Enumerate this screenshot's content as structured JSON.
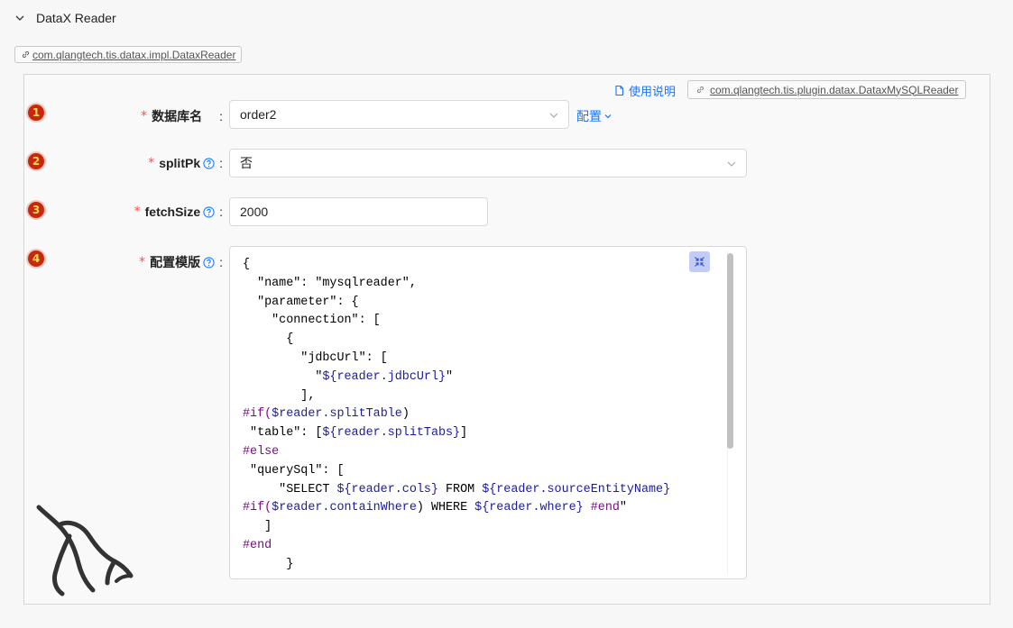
{
  "section": {
    "title": "DataX Reader",
    "impl_class": "com.qlangtech.tis.datax.impl.DataxReader"
  },
  "plugin": {
    "doc_link": "使用说明",
    "class_name": "com.qlangtech.tis.plugin.datax.DataxMySQLReader"
  },
  "fields": [
    {
      "index": "1",
      "label": "数据库名",
      "value": "order2",
      "config_link": "配置"
    },
    {
      "index": "2",
      "label": "splitPk",
      "value": "否"
    },
    {
      "index": "3",
      "label": "fetchSize",
      "value": "2000"
    },
    {
      "index": "4",
      "label": "配置模版"
    }
  ],
  "editor": {
    "lines": [
      [
        {
          "t": "{",
          "c": ""
        }
      ],
      [
        {
          "t": "  \"name\": \"mysqlreader\",",
          "c": ""
        }
      ],
      [
        {
          "t": "  \"parameter\": {",
          "c": ""
        }
      ],
      [
        {
          "t": "    \"connection\": [",
          "c": ""
        }
      ],
      [
        {
          "t": "      {",
          "c": ""
        }
      ],
      [
        {
          "t": "        \"jdbcUrl\": [",
          "c": ""
        }
      ],
      [
        {
          "t": "          \"",
          "c": ""
        },
        {
          "t": "${reader.jdbcUrl}",
          "c": "var"
        },
        {
          "t": "\"",
          "c": ""
        }
      ],
      [
        {
          "t": "        ],",
          "c": ""
        }
      ],
      [
        {
          "t": "#if(",
          "c": "kw"
        },
        {
          "t": "$reader.splitTable",
          "c": "var"
        },
        {
          "t": ")",
          "c": ""
        }
      ],
      [
        {
          "t": " \"table\": [",
          "c": ""
        },
        {
          "t": "${reader.splitTabs}",
          "c": "var"
        },
        {
          "t": "]",
          "c": ""
        }
      ],
      [
        {
          "t": "#else",
          "c": "kw"
        }
      ],
      [
        {
          "t": " \"querySql\": [",
          "c": ""
        }
      ],
      [
        {
          "t": "     \"SELECT ",
          "c": ""
        },
        {
          "t": "${reader.cols}",
          "c": "var"
        },
        {
          "t": " FROM ",
          "c": ""
        },
        {
          "t": "${reader.sourceEntityName}",
          "c": "var"
        }
      ],
      [
        {
          "t": "#if(",
          "c": "kw"
        },
        {
          "t": "$reader.containWhere",
          "c": "var"
        },
        {
          "t": ") WHERE ",
          "c": ""
        },
        {
          "t": "${reader.where}",
          "c": "var"
        },
        {
          "t": " ",
          "c": ""
        },
        {
          "t": "#end",
          "c": "kw"
        },
        {
          "t": "\"",
          "c": ""
        }
      ],
      [
        {
          "t": "   ]",
          "c": ""
        }
      ],
      [
        {
          "t": "#end",
          "c": "kw"
        }
      ],
      [
        {
          "t": "      }",
          "c": ""
        }
      ]
    ]
  },
  "icons": {
    "collapse": "chevron-down-icon",
    "link": "link-icon",
    "doc": "document-icon",
    "help": "question-circle-icon",
    "shrink": "shrink-icon",
    "mascot": "mysql-dolphin-icon"
  },
  "colors": {
    "accent": "#1677ff",
    "required": "#ff4d4f",
    "badge": "#c8270f",
    "variable": "#1a1aa6",
    "keyword": "#7a0c85"
  }
}
